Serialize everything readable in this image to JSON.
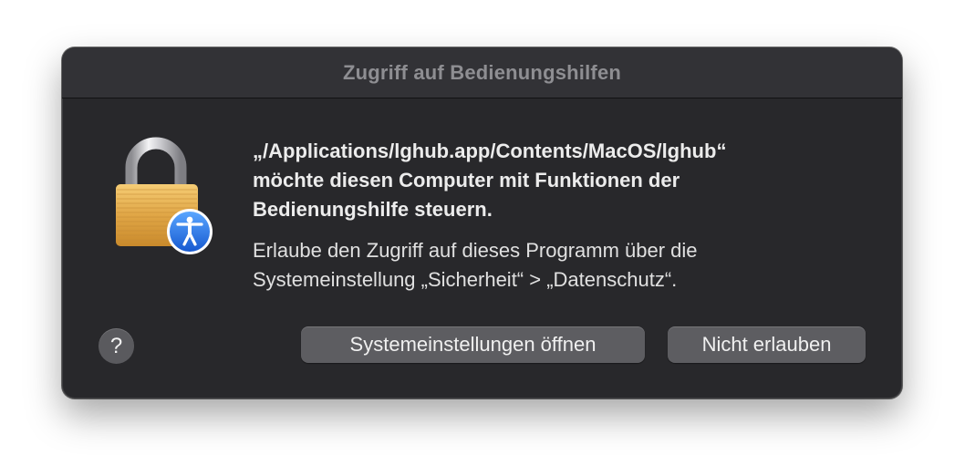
{
  "dialog": {
    "title": "Zugriff auf Bedienungshilfen",
    "headline_line1": "„/Applications/lghub.app/Contents/MacOS/lghub“",
    "headline_line2": "möchte diesen Computer mit Funktionen der",
    "headline_line3": "Bedienungshilfe steuern.",
    "body_line1": "Erlaube den Zugriff auf dieses Programm über die",
    "body_line2": "Systemeinstellung „Sicherheit“ > „Datenschutz“.",
    "help_label": "?",
    "open_settings_label": "Systemeinstellungen öffnen",
    "deny_label": "Nicht erlauben"
  },
  "icons": {
    "lock": "lock-icon",
    "accessibility": "accessibility-icon",
    "help": "help-icon"
  },
  "colors": {
    "dialog_bg": "#28282b",
    "titlebar_bg": "#323236",
    "button_bg": "#5d5d61",
    "accent_blue": "#1e6fe0",
    "lock_gold": "#e2aa4a"
  }
}
